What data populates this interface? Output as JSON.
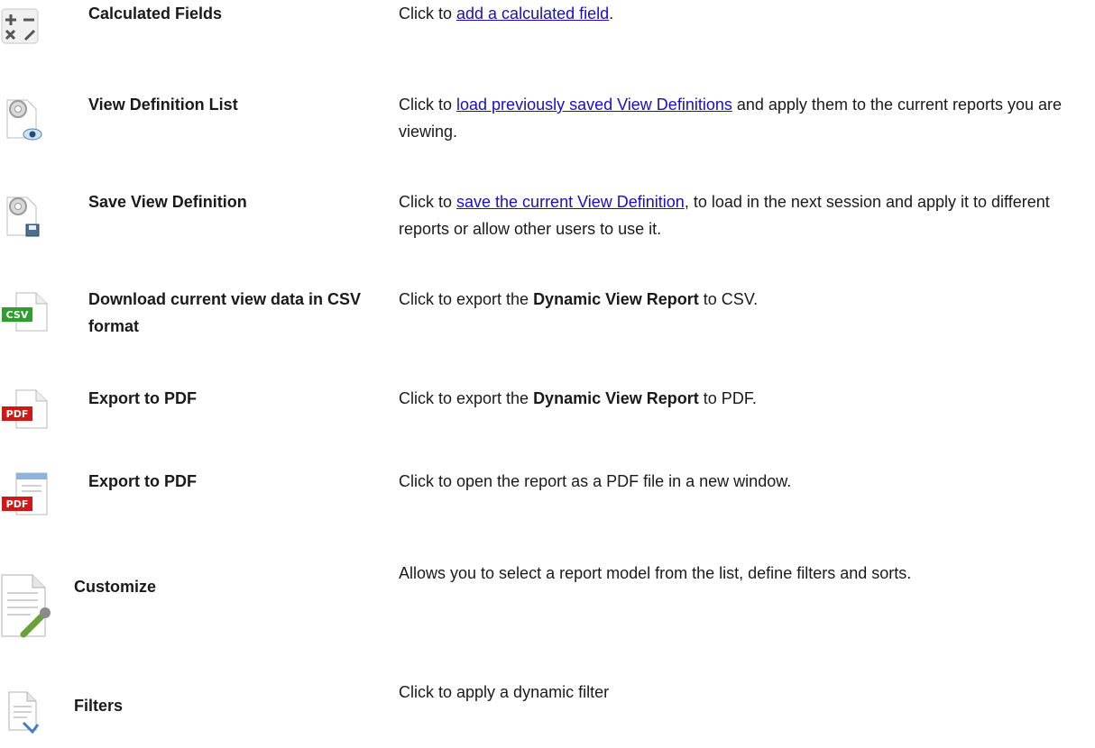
{
  "rows": [
    {
      "icon": "calculator-icon",
      "name": "Calculated Fields",
      "desc_pre": "Click to ",
      "link": "add a calculated field",
      "desc_post": "."
    },
    {
      "icon": "view-definition-list-icon",
      "name": "View Definition List",
      "desc_pre": "Click to ",
      "link": "load previously saved View Definitions",
      "desc_post": " and apply them to the current reports you are viewing."
    },
    {
      "icon": "save-view-definition-icon",
      "name": "Save View Definition",
      "desc_pre": "Click to ",
      "link": "save the current View Definition",
      "desc_post": ", to load in the next session and apply it to different reports or allow other users to use it."
    },
    {
      "icon": "csv-file-icon",
      "icon_text": "CSV",
      "name": "Download current view data in CSV format",
      "desc_pre": "Click to export the ",
      "bold": "Dynamic View Report",
      "desc_post": " to CSV."
    },
    {
      "icon": "pdf-file-icon",
      "icon_text": "PDF",
      "name": "Export to PDF",
      "desc_pre": "Click to export the ",
      "bold": "Dynamic View Report",
      "desc_post": " to PDF."
    },
    {
      "icon": "pdf-window-icon",
      "icon_text": "PDF",
      "name": "Export to PDF",
      "desc": "Click to open the report as a PDF file in a new window."
    },
    {
      "icon": "customize-document-icon",
      "name": "Customize",
      "desc": "Allows you to select a report model from the list, define filters and sorts."
    },
    {
      "icon": "filter-document-icon",
      "name": "Filters",
      "desc": "Click to apply a dynamic filter"
    }
  ],
  "colors": {
    "link": "#1a0dcc",
    "csv_badge": "#2e9e2e",
    "pdf_badge": "#d01818"
  }
}
